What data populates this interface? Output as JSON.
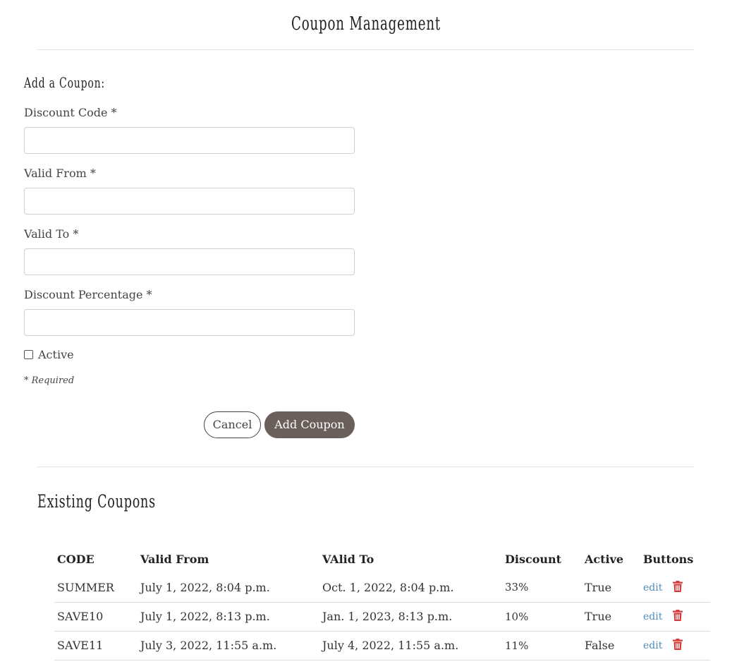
{
  "header": {
    "title": "Coupon Management"
  },
  "form": {
    "heading": "Add a Coupon:",
    "fields": [
      {
        "label": "Discount Code *",
        "value": ""
      },
      {
        "label": "Valid From *",
        "value": ""
      },
      {
        "label": "Valid To *",
        "value": ""
      },
      {
        "label": "Discount Percentage *",
        "value": ""
      }
    ],
    "active_label": "Active",
    "active_checked": false,
    "required_note": "* Required",
    "cancel_label": "Cancel",
    "submit_label": "Add Coupon"
  },
  "existing": {
    "heading": "Existing Coupons",
    "columns": [
      "CODE",
      "Valid From",
      "VAlid To",
      "Discount",
      "Active",
      "Buttons"
    ],
    "rows": [
      {
        "code": "SUMMER",
        "valid_from": "July 1, 2022, 8:04 p.m.",
        "valid_to": "Oct. 1, 2022, 8:04 p.m.",
        "discount": "33%",
        "active": "True",
        "edit": "edit"
      },
      {
        "code": "SAVE10",
        "valid_from": "July 1, 2022, 8:13 p.m.",
        "valid_to": "Jan. 1, 2023, 8:13 p.m.",
        "discount": "10%",
        "active": "True",
        "edit": "edit"
      },
      {
        "code": "SAVE11",
        "valid_from": "July 3, 2022, 11:55 a.m.",
        "valid_to": "July 4, 2022, 11:55 a.m.",
        "discount": "11%",
        "active": "False",
        "edit": "edit"
      }
    ]
  },
  "colors": {
    "primary_button": "#6b5f5b",
    "link": "#4a8db8",
    "delete_icon": "#d33a3a"
  },
  "icons": {
    "delete": "trash-icon"
  }
}
